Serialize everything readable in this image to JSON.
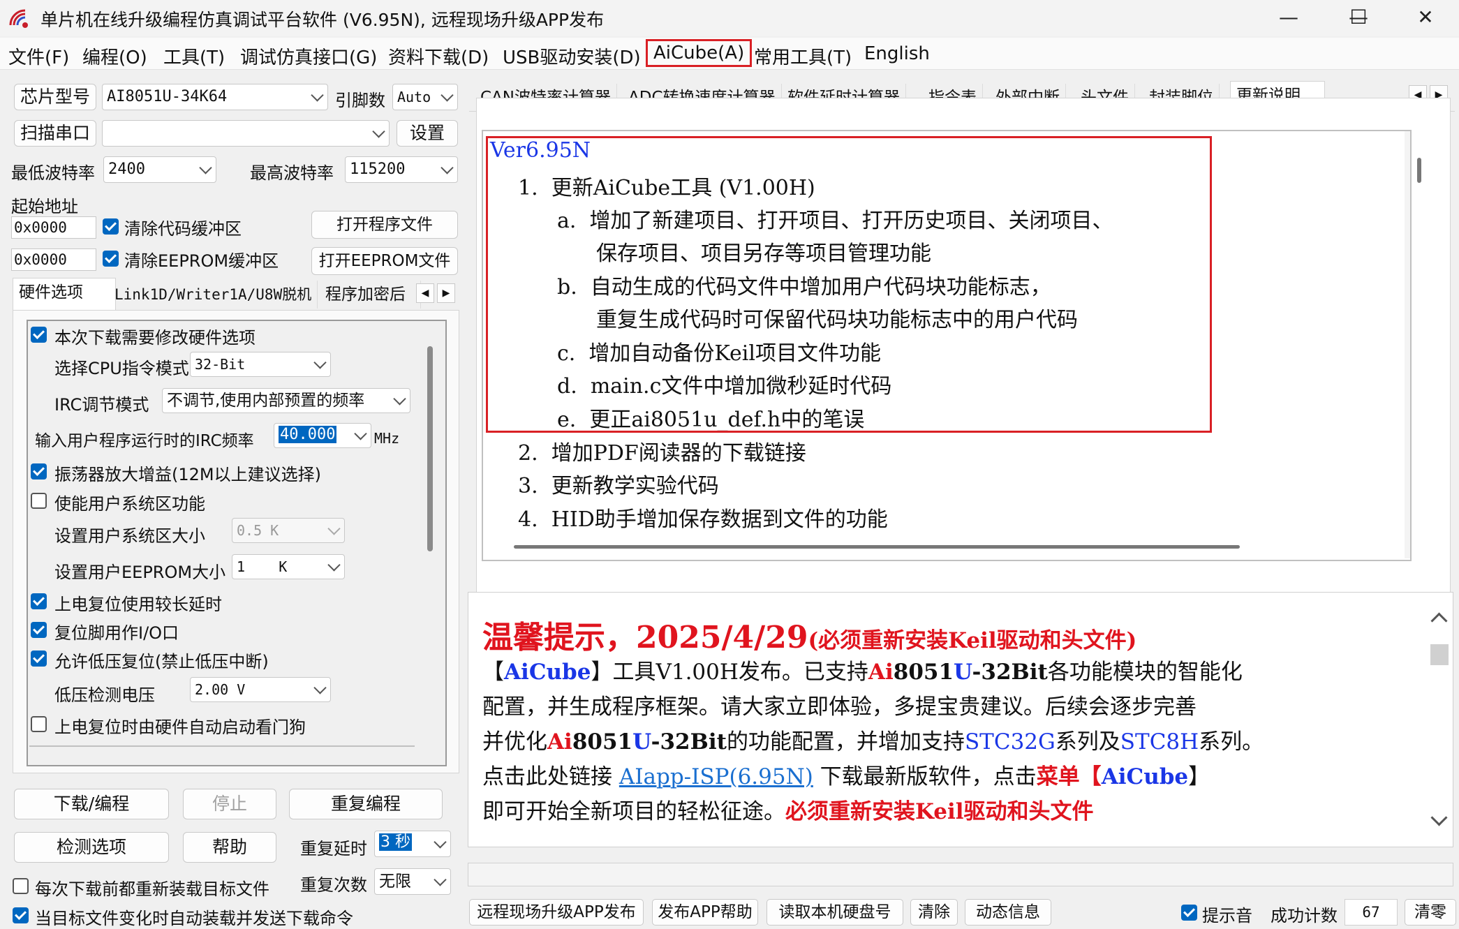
{
  "window": {
    "title": "单片机在线升级编程仿真调试平台软件 (V6.95N), 远程现场升级APP发布",
    "minimize": "—",
    "maximize": "☐",
    "close": "✕"
  },
  "menu": [
    "文件(F)",
    "编程(O)",
    "工具(T)",
    "调试仿真接口(G)",
    "资料下载(D)",
    "USB驱动安装(D)",
    "AiCube(A)",
    "常用工具(T)",
    "English"
  ],
  "left": {
    "chip_model_label": "芯片型号",
    "chip_model": "AI8051U-34K64",
    "pins_label": "引脚数",
    "pins": "Auto",
    "scan_port": "扫描串口",
    "port": "",
    "settings": "设置",
    "min_baud_label": "最低波特率",
    "min_baud": "2400",
    "max_baud_label": "最高波特率",
    "max_baud": "115200",
    "start_addr_label": "起始地址",
    "addr1": "0x0000",
    "addr2": "0x0000",
    "clear_code": "清除代码缓冲区",
    "clear_eeprom": "清除EEPROM缓冲区",
    "open_program": "打开程序文件",
    "open_eeprom": "打开EEPROM文件",
    "tabs": [
      "硬件选项",
      "Link1D/Writer1A/U8W脱机",
      "程序加密后"
    ],
    "hw": {
      "modify_hw": "本次下载需要修改硬件选项",
      "cpu_mode_label": "选择CPU指令模式",
      "cpu_mode": "32-Bit",
      "irc_mode_label": "IRC调节模式",
      "irc_mode": "不调节,使用内部预置的频率",
      "irc_freq_label": "输入用户程序运行时的IRC频率",
      "irc_freq": "40.000",
      "irc_unit": "MHz",
      "osc_gain": "振荡器放大增益(12M以上建议选择)",
      "user_sys": "使能用户系统区功能",
      "user_sys_size_label": "设置用户系统区大小",
      "user_sys_size": "0.5 K",
      "user_eeprom_label": "设置用户EEPROM大小",
      "user_eeprom": "1    K",
      "long_delay": "上电复位使用较长延时",
      "reset_io": "复位脚用作I/O口",
      "lvr": "允许低压复位(禁止低压中断)",
      "lvd_label": "低压检测电压",
      "lvd": "2.00 V",
      "wdt": "上电复位时由硬件自动启动看门狗"
    },
    "download": "下载/编程",
    "stop": "停止",
    "reprogram": "重复编程",
    "check": "检测选项",
    "help": "帮助",
    "repeat_delay_label": "重复延时",
    "repeat_delay": "3 秒",
    "repeat_count_label": "重复次数",
    "repeat_count": "无限",
    "reload_each": "每次下载前都重新装载目标文件",
    "auto_load": "当目标文件变化时自动装载并发送下载命令"
  },
  "right_tabs": [
    "CAN波特率计算器",
    "ADC转换速度计算器",
    "软件延时计算器",
    "指令表",
    "外部中断",
    "头文件",
    "封装脚位",
    "更新说明"
  ],
  "notes": {
    "version": "Ver6.95N",
    "n1": "1.  更新AiCube工具 (V1.00H)",
    "a1": "a.  增加了新建项目、打开项目、打开历史项目、关闭项目、",
    "a2": "保存项目、项目另存等项目管理功能",
    "b1": "b.  自动生成的代码文件中增加用户代码块功能标志，",
    "b2": "重复生成代码时可保留代码块功能标志中的用户代码",
    "c": "c.  增加自动备份Keil项目文件功能",
    "d": "d.  main.c文件中增加微秒延时代码",
    "e": "e.  更正ai8051u_def.h中的笔误",
    "n2": "2.  增加PDF阅读器的下载链接",
    "n3": "3.  更新教学实验代码",
    "n4": "4.  HID助手增加保存数据到文件的功能"
  },
  "tips": {
    "title": "温馨提示，2025/4/29",
    "title_note": "(必须重新安装Keil驱动和头文件)",
    "l2_a": "【",
    "l2_b": "AiCube",
    "l2_c": "】工具V1.00H发布。已支持",
    "l2_d": "Ai",
    "l2_e": "8051",
    "l2_f": "U",
    "l2_g": "-32Bit",
    "l2_h": "各功能模块的智能化",
    "l3": "配置，并生成程序框架。请大家立即体验，多提宝贵建议。后续会逐步完善",
    "l4_a": "并优化",
    "l4_b": "Ai",
    "l4_c": "8051",
    "l4_d": "U",
    "l4_e": "-32Bit",
    "l4_f": "的功能配置，并增加支持",
    "l4_g": "STC32G",
    "l4_h": "系列及",
    "l4_i": "STC8H",
    "l4_j": "系列。",
    "l5_a": "点击此处链接 ",
    "l5_link": "AIapp-ISP(6.95N)",
    "l5_b": " 下载最新版软件，点击",
    "l5_c": "菜单【",
    "l5_d": "AiCube",
    "l5_e": "】",
    "l6_a": "即可开始全新项目的轻松征途。",
    "l6_b": "必须重新安装Keil驱动和头文件"
  },
  "bottom": {
    "remote_app": "远程现场升级APP发布",
    "app_help": "发布APP帮助",
    "read_disk": "读取本机硬盘号",
    "clear": "清除",
    "dynamic": "动态信息",
    "sound": "提示音",
    "success_label": "成功计数",
    "success_count": "67",
    "reset": "清零"
  }
}
